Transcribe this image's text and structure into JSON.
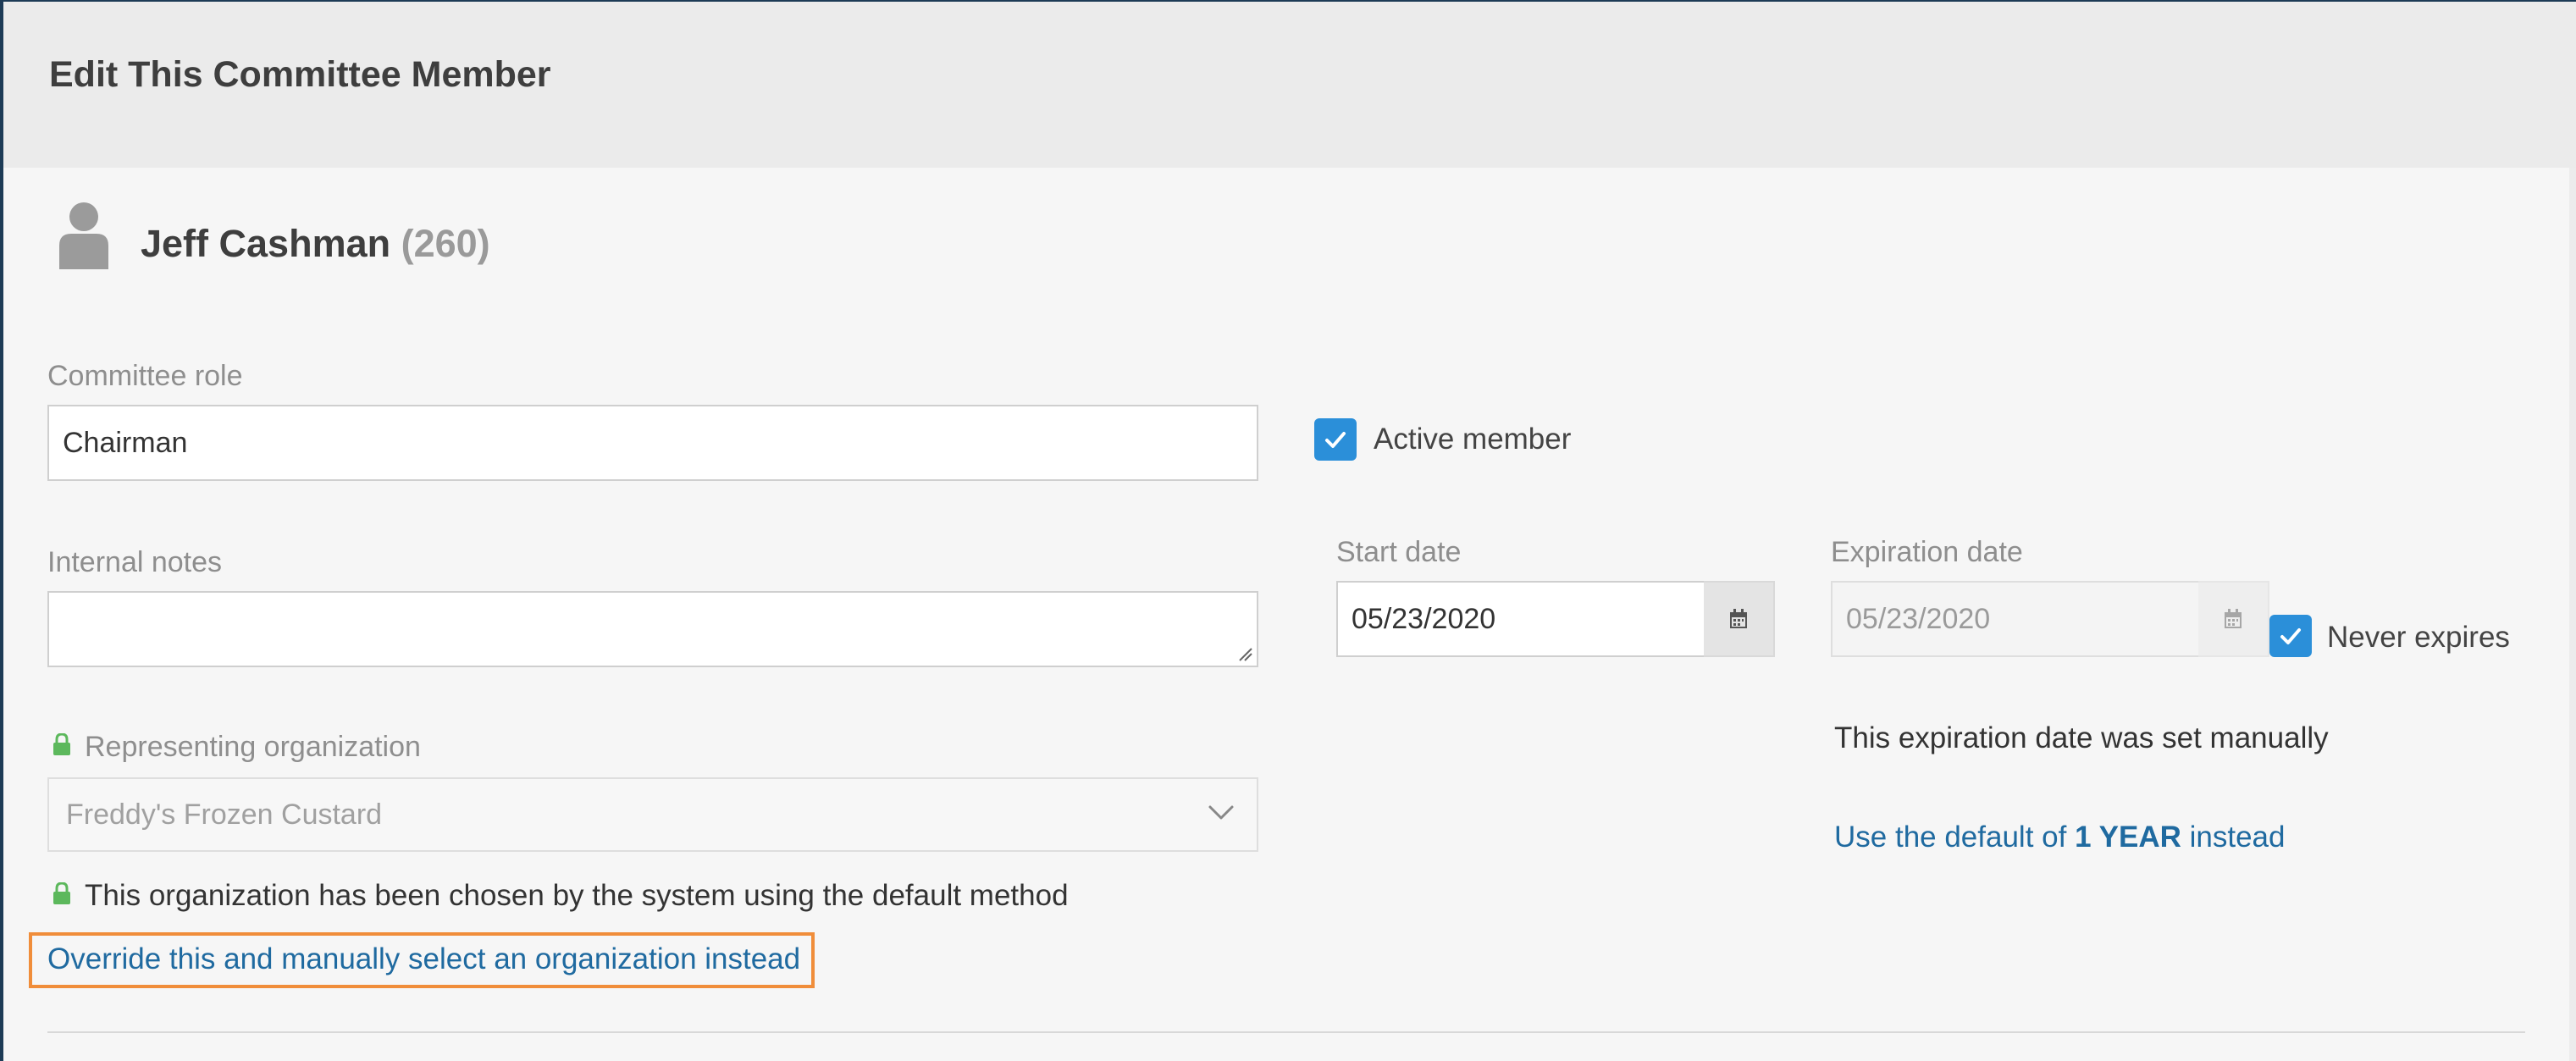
{
  "dialog": {
    "title": "Edit This Committee Member"
  },
  "member": {
    "name": "Jeff Cashman",
    "id_display": "(260)"
  },
  "committee_role": {
    "label": "Committee role",
    "value": "Chairman"
  },
  "active_member": {
    "label": "Active member",
    "checked": true
  },
  "internal_notes": {
    "label": "Internal notes",
    "value": ""
  },
  "start_date": {
    "label": "Start date",
    "value": "05/23/2020"
  },
  "expiration_date": {
    "label": "Expiration date",
    "value": "05/23/2020",
    "disabled": true
  },
  "never_expires": {
    "label": "Never expires",
    "checked": true
  },
  "expiration_note": "This expiration date was set manually",
  "use_default_link": {
    "prefix": "Use the default of ",
    "bold": "1 YEAR",
    "suffix": " instead"
  },
  "representing_org": {
    "label": "Representing organization",
    "value": "Freddy's Frozen Custard",
    "locked": true,
    "note": "This organization has been chosen by the system using the default method",
    "override_link": "Override this and manually select an organization instead"
  },
  "icons": {
    "person": "person-icon",
    "calendar": "calendar-icon",
    "lock": "lock-icon",
    "check": "checkmark-icon",
    "chevron": "chevron-down-icon",
    "resize": "resize-handle-icon"
  },
  "colors": {
    "accent": "#2b8fd9",
    "link": "#1f6aa0",
    "lock": "#5cb85c",
    "highlight": "#f08d3a",
    "header_bg": "#ebebeb",
    "body_bg": "#f6f6f6"
  }
}
